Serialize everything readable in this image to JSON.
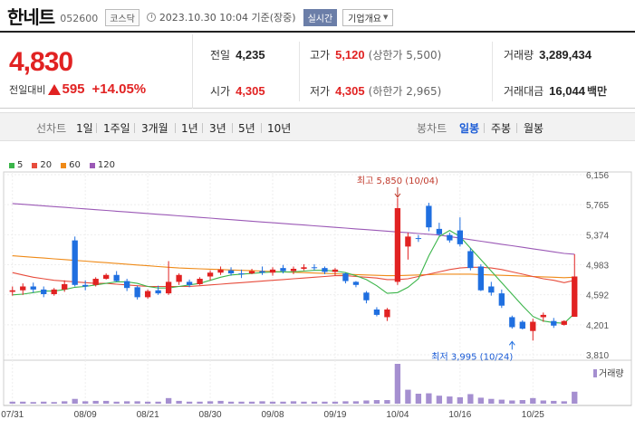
{
  "header": {
    "name": "한네트",
    "code": "052600",
    "market": "코스닥",
    "timestamp": "2023.10.30 10:04 기준(장중)",
    "realtime_label": "실시간",
    "company_info_label": "기업개요"
  },
  "quote": {
    "price": "4,830",
    "change_label": "전일대비",
    "change_amount": "595",
    "change_percent": "+14.05%",
    "prev_close_label": "전일",
    "prev_close": "4,235",
    "high_label": "고가",
    "high": "5,120",
    "upper_limit": "(상한가 5,500)",
    "volume_label": "거래량",
    "volume": "3,289,434",
    "open_label": "시가",
    "open": "4,305",
    "low_label": "저가",
    "low": "4,305",
    "lower_limit": "(하한가 2,965)",
    "trade_value_label": "거래대금",
    "trade_value": "16,044",
    "trade_value_unit": "백만"
  },
  "periods": {
    "line_chart_label": "선차트",
    "line_items": [
      "1일",
      "1주일",
      "3개월",
      "1년",
      "3년",
      "5년",
      "10년"
    ],
    "candle_chart_label": "봉차트",
    "candle_items": [
      "일봉",
      "주봉",
      "월봉"
    ],
    "active": "일봉"
  },
  "colors": {
    "up": "#e12222",
    "down": "#1f6fe0",
    "ma5": "#3bb54a",
    "ma20": "#e74c3c",
    "ma60": "#ef8a17",
    "ma120": "#9b59b6",
    "volume": "#a58fd0"
  },
  "chart_data": {
    "type": "candlestick",
    "legend": [
      "5",
      "20",
      "60",
      "120"
    ],
    "y_ticks": [
      "6,156",
      "5,765",
      "5,374",
      "4,983",
      "4,592",
      "4,201",
      "3,810"
    ],
    "ylim": [
      3810,
      6156
    ],
    "x_tick_labels": [
      "07/31",
      "08/09",
      "08/21",
      "08/30",
      "09/08",
      "09/19",
      "10/04",
      "10/16",
      "10/25"
    ],
    "x_tick_index": [
      0,
      7,
      13,
      19,
      25,
      31,
      37,
      43,
      50
    ],
    "volume_label": "거래량",
    "annotations": {
      "high_text": "최고 5,850 (10/04)",
      "low_text": "최저 3,995 (10/24)",
      "high_index": 37,
      "low_index": 48,
      "high_value": 5850,
      "low_value": 3995
    },
    "candles": [
      {
        "o": 4630,
        "h": 4700,
        "l": 4580,
        "c": 4650
      },
      {
        "o": 4650,
        "h": 4740,
        "l": 4590,
        "c": 4700
      },
      {
        "o": 4700,
        "h": 4750,
        "l": 4620,
        "c": 4660
      },
      {
        "o": 4660,
        "h": 4700,
        "l": 4560,
        "c": 4600
      },
      {
        "o": 4600,
        "h": 4680,
        "l": 4580,
        "c": 4660
      },
      {
        "o": 4660,
        "h": 4780,
        "l": 4630,
        "c": 4730
      },
      {
        "o": 5300,
        "h": 5350,
        "l": 4700,
        "c": 4720
      },
      {
        "o": 4720,
        "h": 4780,
        "l": 4650,
        "c": 4700
      },
      {
        "o": 4720,
        "h": 4820,
        "l": 4700,
        "c": 4800
      },
      {
        "o": 4800,
        "h": 4870,
        "l": 4790,
        "c": 4850
      },
      {
        "o": 4850,
        "h": 4900,
        "l": 4760,
        "c": 4770
      },
      {
        "o": 4770,
        "h": 4800,
        "l": 4640,
        "c": 4680
      },
      {
        "o": 4690,
        "h": 4710,
        "l": 4530,
        "c": 4560
      },
      {
        "o": 4560,
        "h": 4660,
        "l": 4540,
        "c": 4640
      },
      {
        "o": 4650,
        "h": 4710,
        "l": 4590,
        "c": 4610
      },
      {
        "o": 4610,
        "h": 5030,
        "l": 4590,
        "c": 4760
      },
      {
        "o": 4760,
        "h": 4870,
        "l": 4720,
        "c": 4850
      },
      {
        "o": 4760,
        "h": 4790,
        "l": 4690,
        "c": 4720
      },
      {
        "o": 4730,
        "h": 4820,
        "l": 4720,
        "c": 4800
      },
      {
        "o": 4830,
        "h": 4910,
        "l": 4780,
        "c": 4880
      },
      {
        "o": 4880,
        "h": 4960,
        "l": 4850,
        "c": 4920
      },
      {
        "o": 4910,
        "h": 4950,
        "l": 4840,
        "c": 4870
      },
      {
        "o": 4870,
        "h": 4920,
        "l": 4810,
        "c": 4860
      },
      {
        "o": 4870,
        "h": 4930,
        "l": 4860,
        "c": 4900
      },
      {
        "o": 4900,
        "h": 4960,
        "l": 4850,
        "c": 4880
      },
      {
        "o": 4880,
        "h": 4950,
        "l": 4840,
        "c": 4920
      },
      {
        "o": 4940,
        "h": 4980,
        "l": 4870,
        "c": 4900
      },
      {
        "o": 4900,
        "h": 4960,
        "l": 4860,
        "c": 4930
      },
      {
        "o": 4930,
        "h": 4990,
        "l": 4910,
        "c": 4950
      },
      {
        "o": 4950,
        "h": 4990,
        "l": 4910,
        "c": 4940
      },
      {
        "o": 4940,
        "h": 4960,
        "l": 4860,
        "c": 4890
      },
      {
        "o": 4890,
        "h": 4940,
        "l": 4840,
        "c": 4920
      },
      {
        "o": 4870,
        "h": 4880,
        "l": 4740,
        "c": 4770
      },
      {
        "o": 4760,
        "h": 4770,
        "l": 4690,
        "c": 4720
      },
      {
        "o": 4620,
        "h": 4640,
        "l": 4480,
        "c": 4520
      },
      {
        "o": 4400,
        "h": 4430,
        "l": 4310,
        "c": 4330
      },
      {
        "o": 4300,
        "h": 4420,
        "l": 4250,
        "c": 4400
      },
      {
        "o": 4760,
        "h": 5850,
        "l": 4720,
        "c": 5720
      },
      {
        "o": 5220,
        "h": 5400,
        "l": 5050,
        "c": 5350
      },
      {
        "o": 5330,
        "h": 5370,
        "l": 5280,
        "c": 5320
      },
      {
        "o": 5750,
        "h": 5790,
        "l": 5420,
        "c": 5470
      },
      {
        "o": 5450,
        "h": 5530,
        "l": 5360,
        "c": 5380
      },
      {
        "o": 5370,
        "h": 5400,
        "l": 5270,
        "c": 5300
      },
      {
        "o": 5430,
        "h": 5600,
        "l": 5220,
        "c": 5250
      },
      {
        "o": 5160,
        "h": 5200,
        "l": 4910,
        "c": 4940
      },
      {
        "o": 4960,
        "h": 4990,
        "l": 4640,
        "c": 4650
      },
      {
        "o": 4700,
        "h": 4760,
        "l": 4580,
        "c": 4620
      },
      {
        "o": 4610,
        "h": 4660,
        "l": 4420,
        "c": 4450
      },
      {
        "o": 4300,
        "h": 4320,
        "l": 4150,
        "c": 4170
      },
      {
        "o": 4240,
        "h": 4260,
        "l": 4140,
        "c": 4150
      },
      {
        "o": 4120,
        "h": 4280,
        "l": 3995,
        "c": 4240
      },
      {
        "o": 4300,
        "h": 4360,
        "l": 4240,
        "c": 4330
      },
      {
        "o": 4250,
        "h": 4290,
        "l": 4160,
        "c": 4190
      },
      {
        "o": 4200,
        "h": 4260,
        "l": 4190,
        "c": 4250
      },
      {
        "o": 4305,
        "h": 5120,
        "l": 4305,
        "c": 4830
      }
    ],
    "volume": [
      5,
      5,
      4,
      5,
      4,
      6,
      12,
      6,
      7,
      7,
      5,
      6,
      6,
      5,
      5,
      14,
      7,
      5,
      5,
      6,
      7,
      5,
      5,
      5,
      6,
      5,
      5,
      6,
      5,
      5,
      5,
      5,
      6,
      6,
      8,
      9,
      9,
      100,
      35,
      25,
      26,
      20,
      18,
      16,
      24,
      15,
      12,
      10,
      8,
      9,
      14,
      8,
      7,
      6,
      30
    ],
    "ma5": [
      4590,
      4600,
      4620,
      4640,
      4640,
      4660,
      4690,
      4700,
      4720,
      4740,
      4760,
      4760,
      4740,
      4700,
      4680,
      4680,
      4700,
      4720,
      4740,
      4780,
      4820,
      4850,
      4860,
      4870,
      4880,
      4890,
      4890,
      4890,
      4900,
      4910,
      4910,
      4900,
      4880,
      4840,
      4790,
      4710,
      4610,
      4620,
      4690,
      4800,
      5100,
      5350,
      5430,
      5350,
      5200,
      5050,
      4900,
      4750,
      4600,
      4450,
      4310,
      4250,
      4230,
      4220,
      4350
    ],
    "ma20": [
      4880,
      4850,
      4820,
      4800,
      4780,
      4770,
      4760,
      4750,
      4740,
      4740,
      4730,
      4720,
      4710,
      4700,
      4700,
      4700,
      4700,
      4700,
      4710,
      4720,
      4730,
      4740,
      4750,
      4760,
      4770,
      4780,
      4790,
      4800,
      4810,
      4820,
      4830,
      4840,
      4840,
      4830,
      4820,
      4810,
      4790,
      4790,
      4800,
      4830,
      4860,
      4890,
      4920,
      4940,
      4950,
      4950,
      4940,
      4920,
      4890,
      4860,
      4830,
      4800,
      4780,
      4750,
      4780
    ],
    "ma60": [
      5100,
      5090,
      5080,
      5070,
      5060,
      5050,
      5040,
      5030,
      5020,
      5010,
      5000,
      4990,
      4980,
      4970,
      4960,
      4950,
      4940,
      4935,
      4930,
      4925,
      4920,
      4915,
      4910,
      4905,
      4900,
      4895,
      4890,
      4885,
      4880,
      4875,
      4870,
      4865,
      4860,
      4855,
      4850,
      4845,
      4840,
      4840,
      4845,
      4850,
      4855,
      4860,
      4860,
      4860,
      4860,
      4855,
      4850,
      4845,
      4840,
      4835,
      4830,
      4825,
      4820,
      4815,
      4820
    ],
    "ma120": [
      5780,
      5770,
      5760,
      5750,
      5740,
      5730,
      5720,
      5710,
      5700,
      5690,
      5680,
      5670,
      5660,
      5650,
      5640,
      5630,
      5620,
      5610,
      5600,
      5590,
      5580,
      5570,
      5560,
      5550,
      5540,
      5530,
      5520,
      5510,
      5500,
      5490,
      5480,
      5470,
      5460,
      5450,
      5440,
      5430,
      5420,
      5410,
      5400,
      5390,
      5380,
      5370,
      5350,
      5330,
      5310,
      5290,
      5270,
      5250,
      5230,
      5210,
      5190,
      5170,
      5150,
      5130,
      5120
    ]
  }
}
